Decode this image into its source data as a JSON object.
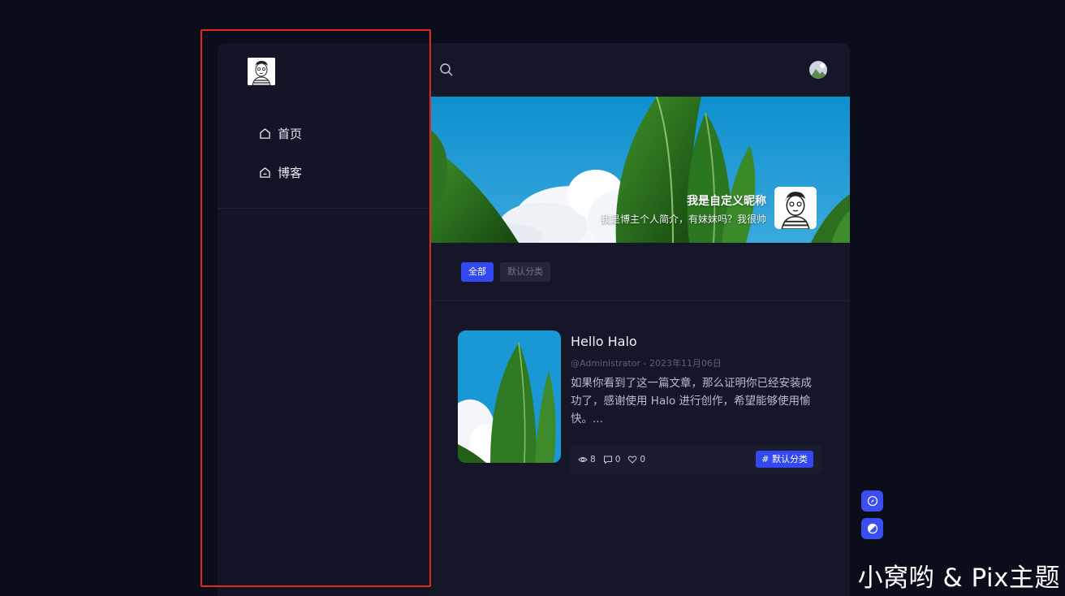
{
  "sidebar": {
    "nav": [
      {
        "label": "首页",
        "icon": "home-icon"
      },
      {
        "label": "博客",
        "icon": "blog-home-icon"
      }
    ]
  },
  "header": {
    "search_icon": "search-icon",
    "user_icon": "user-avatar-icon"
  },
  "profile": {
    "name": "我是自定义昵称",
    "bio": "我是博主个人简介，有妹妹吗？我很帅"
  },
  "categories": [
    {
      "label": "全部",
      "active": true
    },
    {
      "label": "默认分类",
      "active": false
    }
  ],
  "post": {
    "title": "Hello Halo",
    "meta": "@Administrator - 2023年11月06日",
    "excerpt": "如果你看到了这一篇文章，那么证明你已经安装成功了，感谢使用 Halo 进行创作，希望能够使用愉快。...",
    "views": "8",
    "comments": "0",
    "likes": "0",
    "tag": "# 默认分类"
  },
  "colors": {
    "accent": "#3448f2",
    "background": "#0c0d1a",
    "panel": "#141524",
    "highlight": "#e5271f"
  },
  "watermark": "小窝哟 & Pix主题"
}
